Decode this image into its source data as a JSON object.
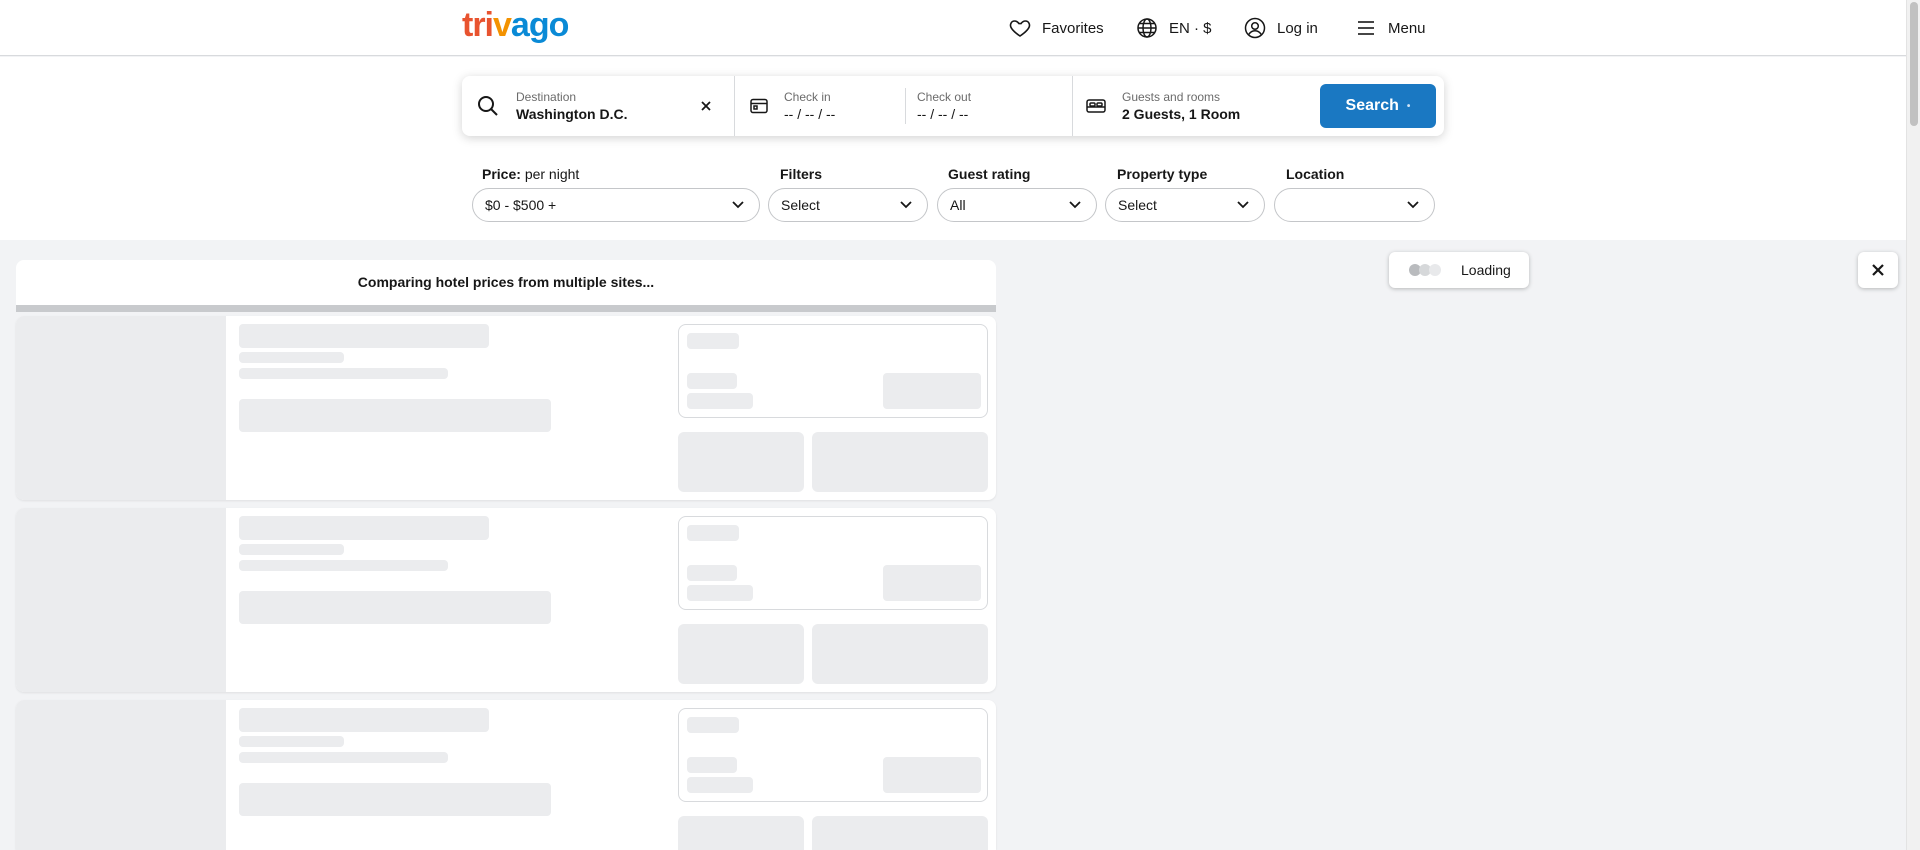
{
  "header": {
    "logo_text": "trivago",
    "favorites_label": "Favorites",
    "language_label": "EN · $",
    "login_label": "Log in",
    "menu_label": "Menu"
  },
  "search": {
    "destination_label": "Destination",
    "destination_value": "Washington D.C.",
    "checkin_label": "Check in",
    "checkin_value": "-- / -- / --",
    "checkout_label": "Check out",
    "checkout_value": "-- / -- / --",
    "guests_label": "Guests and rooms",
    "guests_value": "2 Guests, 1 Room",
    "search_button": "Search"
  },
  "filters": {
    "price_title": "Price:",
    "price_subtitle": "per night",
    "price_value": "$0 - $500 +",
    "filters_title": "Filters",
    "filters_value": "Select",
    "rating_title": "Guest rating",
    "rating_value": "All",
    "property_title": "Property type",
    "property_value": "Select",
    "location_title": "Location",
    "location_value": ""
  },
  "results": {
    "comparing_text": "Comparing hotel prices from multiple sites..."
  },
  "map": {
    "loading_label": "Loading"
  },
  "colors": {
    "brand_blue": "#1a78c2",
    "logo_orange": "#e8532f",
    "logo_blue": "#0a8ad6",
    "skeleton": "#ebecee"
  }
}
